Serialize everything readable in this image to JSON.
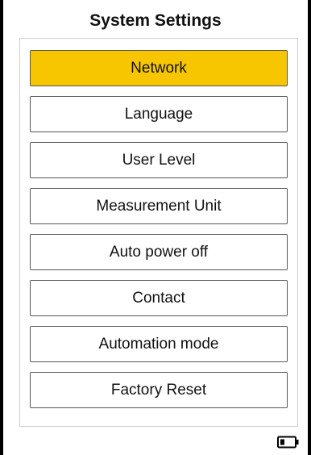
{
  "header": {
    "title": "System Settings"
  },
  "menu": {
    "selected_color": "#f7c600",
    "items": [
      {
        "label": "Network",
        "selected": true
      },
      {
        "label": "Language",
        "selected": false
      },
      {
        "label": "User Level",
        "selected": false
      },
      {
        "label": "Measurement Unit",
        "selected": false
      },
      {
        "label": "Auto power off",
        "selected": false
      },
      {
        "label": "Contact",
        "selected": false
      },
      {
        "label": "Automation mode",
        "selected": false
      },
      {
        "label": "Factory Reset",
        "selected": false
      }
    ]
  },
  "status_bar": {
    "battery_icon": "battery-icon"
  }
}
